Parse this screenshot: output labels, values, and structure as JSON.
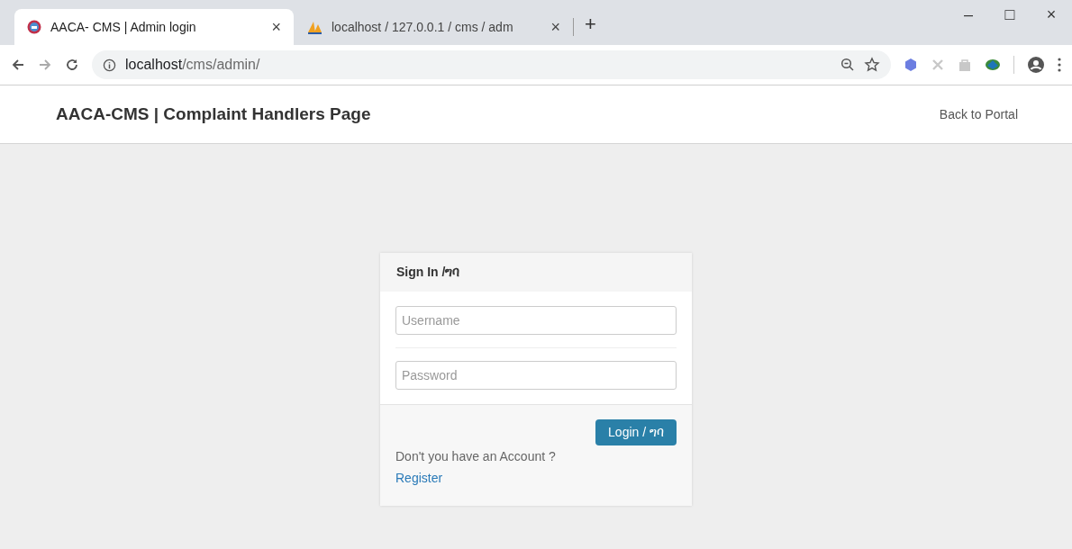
{
  "browser": {
    "tabs": [
      {
        "kind": "site",
        "title": "AACA- CMS | Admin login",
        "close": "×",
        "selected": true
      },
      {
        "kind": "pma",
        "title": "localhost / 127.0.0.1 / cms / adm",
        "close": "×",
        "selected": false
      }
    ],
    "new_tab": "+",
    "window_buttons": [
      "–",
      "□",
      "×"
    ],
    "address": {
      "host": "localhost",
      "path": "/cms/admin/"
    }
  },
  "header": {
    "title": "AACA-CMS | Complaint Handlers Page",
    "link": "Back to Portal"
  },
  "login": {
    "title": "Sign In /ግባ",
    "fields": [
      {
        "placeholder": "Username"
      },
      {
        "placeholder": "Password"
      }
    ],
    "button": "Login / ግባ",
    "prompt": "Don't you have an Account ?",
    "register": "Register"
  }
}
